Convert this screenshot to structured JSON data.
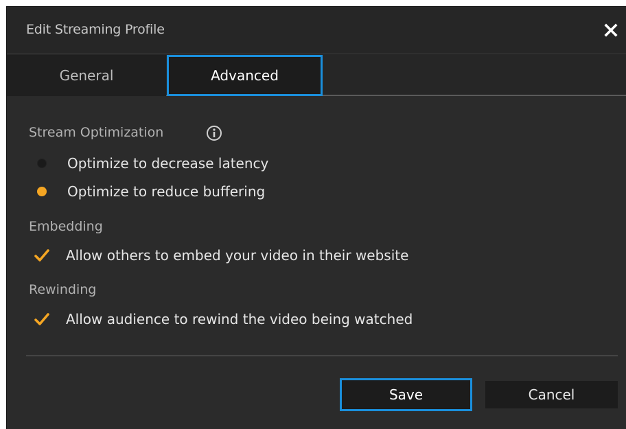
{
  "dialog": {
    "title": "Edit Streaming Profile",
    "close_icon": "close-icon"
  },
  "tabs": [
    {
      "label": "General",
      "active": false
    },
    {
      "label": "Advanced",
      "active": true
    }
  ],
  "stream_optimization": {
    "label": "Stream Optimization",
    "info_icon": "info-icon",
    "options": [
      {
        "label": "Optimize to decrease latency",
        "selected": false
      },
      {
        "label": "Optimize to reduce buffering",
        "selected": true
      }
    ]
  },
  "embedding": {
    "label": "Embedding",
    "option": {
      "label": "Allow others to embed your video in their website",
      "checked": true
    }
  },
  "rewinding": {
    "label": "Rewinding",
    "option": {
      "label": "Allow audience to rewind the video being watched",
      "checked": true
    }
  },
  "buttons": {
    "save_label": "Save",
    "cancel_label": "Cancel"
  },
  "colors": {
    "accent": "#1a8fdc",
    "selected": "#f5a623",
    "background": "#2b2b2b"
  }
}
